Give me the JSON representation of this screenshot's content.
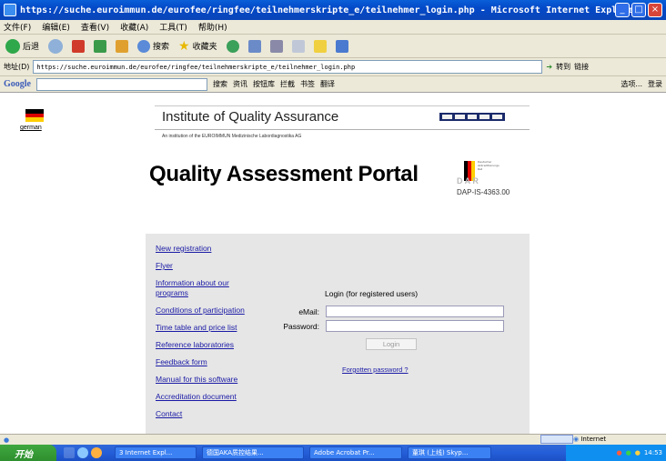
{
  "window": {
    "title": "https://suche.euroimmun.de/eurofee/ringfee/teilnehmerskripte_e/teilnehmer_login.php - Microsoft Internet Explorer"
  },
  "menu": [
    "文件(F)",
    "编辑(E)",
    "查看(V)",
    "收藏(A)",
    "工具(T)",
    "帮助(H)"
  ],
  "toolbar": {
    "back": "后退",
    "search": "搜索",
    "favorites": "收藏夹"
  },
  "address": {
    "label": "地址(D)",
    "url": "https://suche.euroimmun.de/eurofee/ringfee/teilnehmerskripte_e/teilnehmer_login.php",
    "go": "转到",
    "links": "链接"
  },
  "googlebar": {
    "logo": "Google",
    "search": "搜索",
    "news": "资讯",
    "pagerank": "按钮库",
    "blocked": "拦截",
    "bookmarks": "书签",
    "translate": "翻译",
    "options": "选项...",
    "signin": "登录"
  },
  "language": {
    "label": "german"
  },
  "header": {
    "institute": "Institute of Quality Assurance",
    "subtitle": "An institution of the EUROIMMUN Medizinische Labordiagnostika AG",
    "portal_title": "Quality Assessment Portal",
    "accreditation_code": "DAP-IS-4363.00",
    "dak_text": "Deutscher Akkreditierungs Rat"
  },
  "nav": [
    "New registration",
    "Flyer",
    "Information about our programs",
    "Conditions of participation",
    "Time table and price list",
    "Reference laboratories",
    "Feedback form",
    "Manual for this software",
    "Accreditation document",
    "Contact"
  ],
  "login": {
    "heading": "Login (for registered users)",
    "email_label": "eMail:",
    "password_label": "Password:",
    "email_value": "",
    "password_value": "",
    "button": "Login",
    "forgot": "Forgotten password ?"
  },
  "statusbar": {
    "zone": "Internet"
  },
  "taskbar": {
    "start": "开始",
    "tasks": [
      "3 Internet Expl...",
      "德国AKA质控结果...",
      "Adobe Acrobat Pr...",
      "董琪 (上线) Skyp..."
    ],
    "clock": "14:53"
  },
  "colors": {
    "link": "#1a1aa6",
    "panel": "#e6e6e6",
    "titlebar": "#0a5fd8"
  }
}
